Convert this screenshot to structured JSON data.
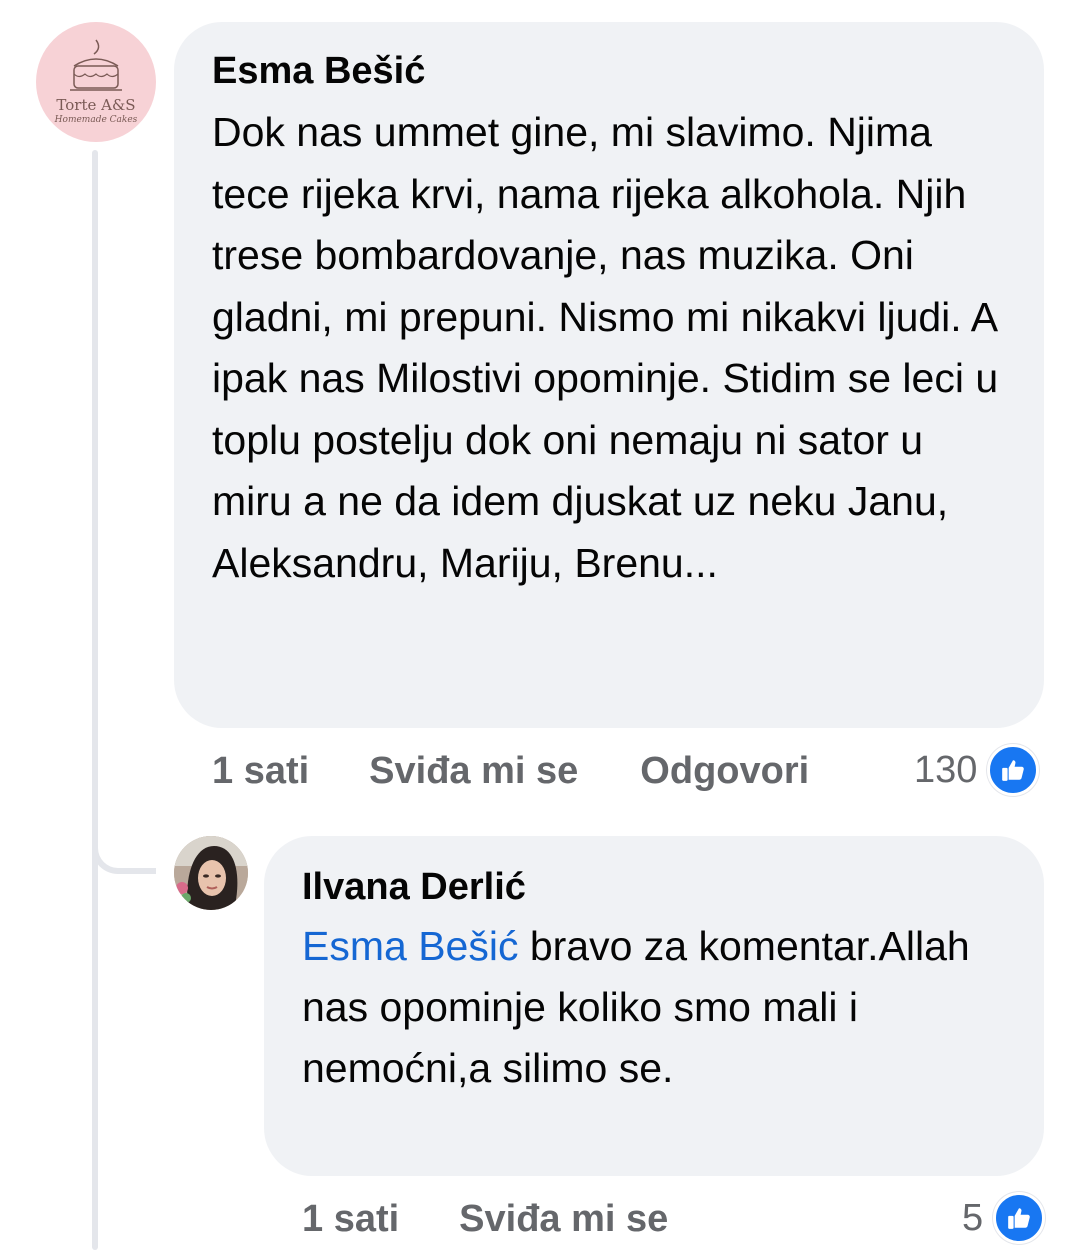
{
  "comment": {
    "author": "Esma Bešić",
    "avatar_brand": "Torte A&S",
    "avatar_subtitle": "Homemade Cakes",
    "text": "Dok nas ummet gine, mi slavimo. Njima tece rijeka krvi, nama rijeka alkohola. Njih trese bombardovanje, nas muzika. Oni gladni, mi prepuni. Nismo mi nikakvi ljudi. A ipak nas Milostivi opominje. Stidim se leci u toplu postelju dok oni nemaju ni sator u miru a ne da idem djuskat uz neku Janu, Aleksandru, Mariju, Brenu...",
    "time": "1 sati",
    "like_label": "Sviđa mi se",
    "reply_label": "Odgovori",
    "reaction_count": "130",
    "reaction_icon": "like-thumb-icon",
    "reaction_color": "#1877f2"
  },
  "reply": {
    "author": "Ilvana Derlić",
    "mention": "Esma Bešić",
    "text": " bravo za komentar.Allah nas opominje koliko smo mali i nemoćni,a silimo se.",
    "time": "1 sati",
    "like_label": "Sviđa mi se",
    "reaction_count": "5",
    "reaction_icon": "like-thumb-icon"
  },
  "colors": {
    "bubble": "#f0f2f5",
    "mention": "#1567d3",
    "meta": "#65676b"
  }
}
